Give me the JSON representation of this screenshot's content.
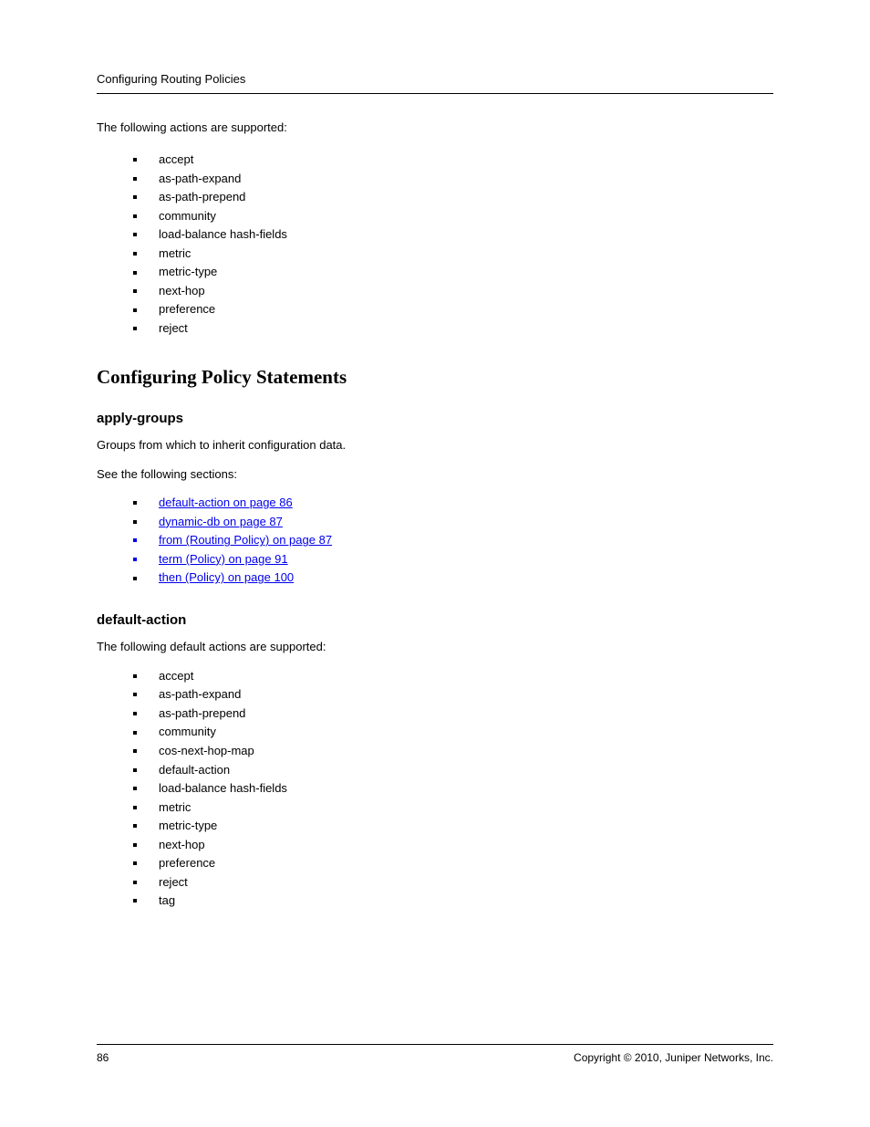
{
  "header": {
    "running_title": "Configuring Routing Policies"
  },
  "intro_1": "The following actions are supported:",
  "actions": [
    "accept",
    "as-path-expand",
    "as-path-prepend",
    "community",
    "load-balance hash-fields",
    "metric",
    "metric-type",
    "next-hop",
    "preference",
    "reject"
  ],
  "section_policy": {
    "title": "Configuring Policy Statements",
    "heading_apply_groups": "apply-groups",
    "para_apply_groups": "Groups from which to inherit configuration data.",
    "para_see_also": "See the following sections:",
    "links": [
      {
        "text": "default-action on page 86",
        "blue_bullet": false
      },
      {
        "text": "dynamic-db on page 87",
        "blue_bullet": false
      },
      {
        "text": "from (Routing Policy) on page 87",
        "blue_bullet": true
      },
      {
        "text": "term (Policy) on page 91",
        "blue_bullet": true
      },
      {
        "text": "then (Policy) on page 100",
        "blue_bullet": false
      }
    ],
    "heading_default_action": "default-action",
    "para_default_action": "The following default actions are supported:",
    "default_actions": [
      "accept",
      "as-path-expand",
      "as-path-prepend",
      "community",
      "cos-next-hop-map",
      "default-action",
      "load-balance hash-fields",
      "metric",
      "metric-type",
      "next-hop",
      "preference",
      "reject",
      "tag"
    ]
  },
  "footer": {
    "page_number": "86",
    "copyright": "Copyright © 2010, Juniper Networks, Inc."
  }
}
